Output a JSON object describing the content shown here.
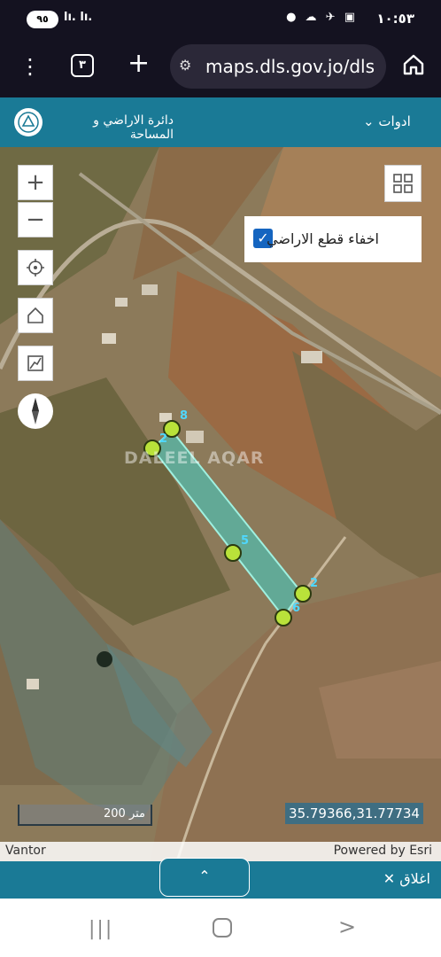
{
  "status_bar": {
    "time": "١٠:٥٣",
    "battery": "٩٥",
    "signal": "lı. lı.",
    "right_icons": "● ☁ ✈ ▣"
  },
  "browser": {
    "tab_count": "٣",
    "url": "maps.dls.gov.jo/dls"
  },
  "app_header": {
    "title": "دائرة الاراضي و المساحة",
    "tools_label": "ادوات"
  },
  "map": {
    "hide_parcels_label": "اخفاء قطع الاراضي",
    "hide_parcels_checked": true,
    "scale_label": "200 متر",
    "coordinates": "35.79366,31.77734",
    "attribution_left": "Vantor",
    "attribution_right": "Powered by Esri",
    "watermark": "DALEEL AQAR",
    "parcel_vertex_labels": [
      "8",
      "2",
      "5",
      "2",
      "6"
    ]
  },
  "bottom_panel": {
    "close_label": "اغلاق",
    "toggle_icon": "chevron-up-icon"
  },
  "colors": {
    "header": "#1a7a96",
    "parcel_fill": "#3fd0c8",
    "vertex": "#b9e23a"
  }
}
